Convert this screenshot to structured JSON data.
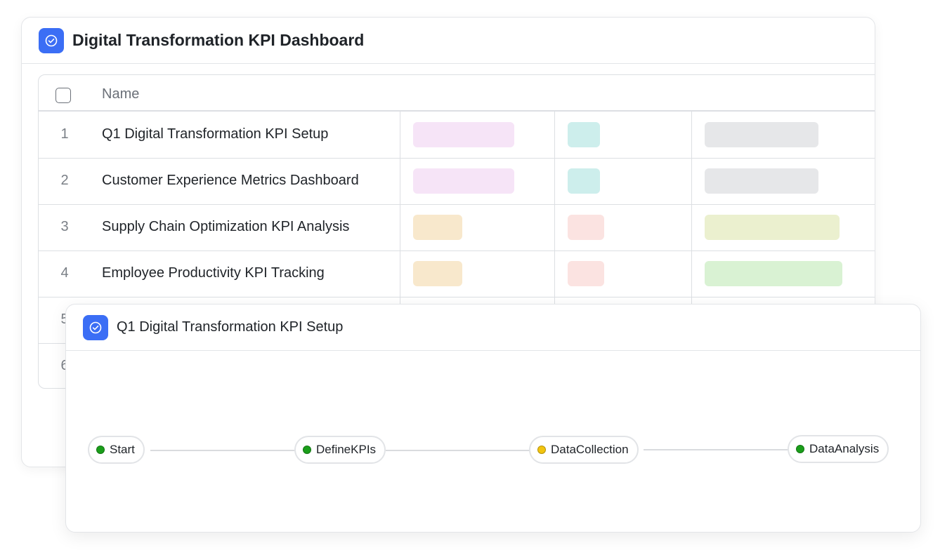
{
  "dashboard": {
    "title": "Digital Transformation KPI Dashboard",
    "table": {
      "columns": {
        "name": "Name"
      },
      "rows": [
        {
          "num": "1",
          "name": "Q1 Digital Transformation KPI Setup"
        },
        {
          "num": "2",
          "name": "Customer Experience Metrics Dashboard"
        },
        {
          "num": "3",
          "name": "Supply Chain Optimization KPI Analysis"
        },
        {
          "num": "4",
          "name": "Employee Productivity KPI Tracking"
        },
        {
          "num": "5",
          "name": ""
        },
        {
          "num": "6",
          "name": ""
        }
      ],
      "colors": {
        "pink": "#f6e4f7",
        "teal": "#cdeeec",
        "gray": "#e6e7e9",
        "peach": "#f8e8cc",
        "salmon": "#fbe3e1",
        "olive": "#ebf0cf",
        "green": "#d9f2d3"
      }
    }
  },
  "detail": {
    "title": "Q1 Digital Transformation KPI Setup",
    "workflow": {
      "nodes": [
        {
          "label": "Start",
          "status": "done",
          "color": "#1a9e1a"
        },
        {
          "label": "DefineKPIs",
          "status": "done",
          "color": "#1a9e1a"
        },
        {
          "label": "DataCollection",
          "status": "in-progress",
          "color": "#f2c40f"
        },
        {
          "label": "DataAnalysis",
          "status": "done",
          "color": "#1a9e1a"
        }
      ]
    }
  },
  "icons": {
    "app": "check-circle-icon"
  },
  "accent": "#3b6ef5"
}
